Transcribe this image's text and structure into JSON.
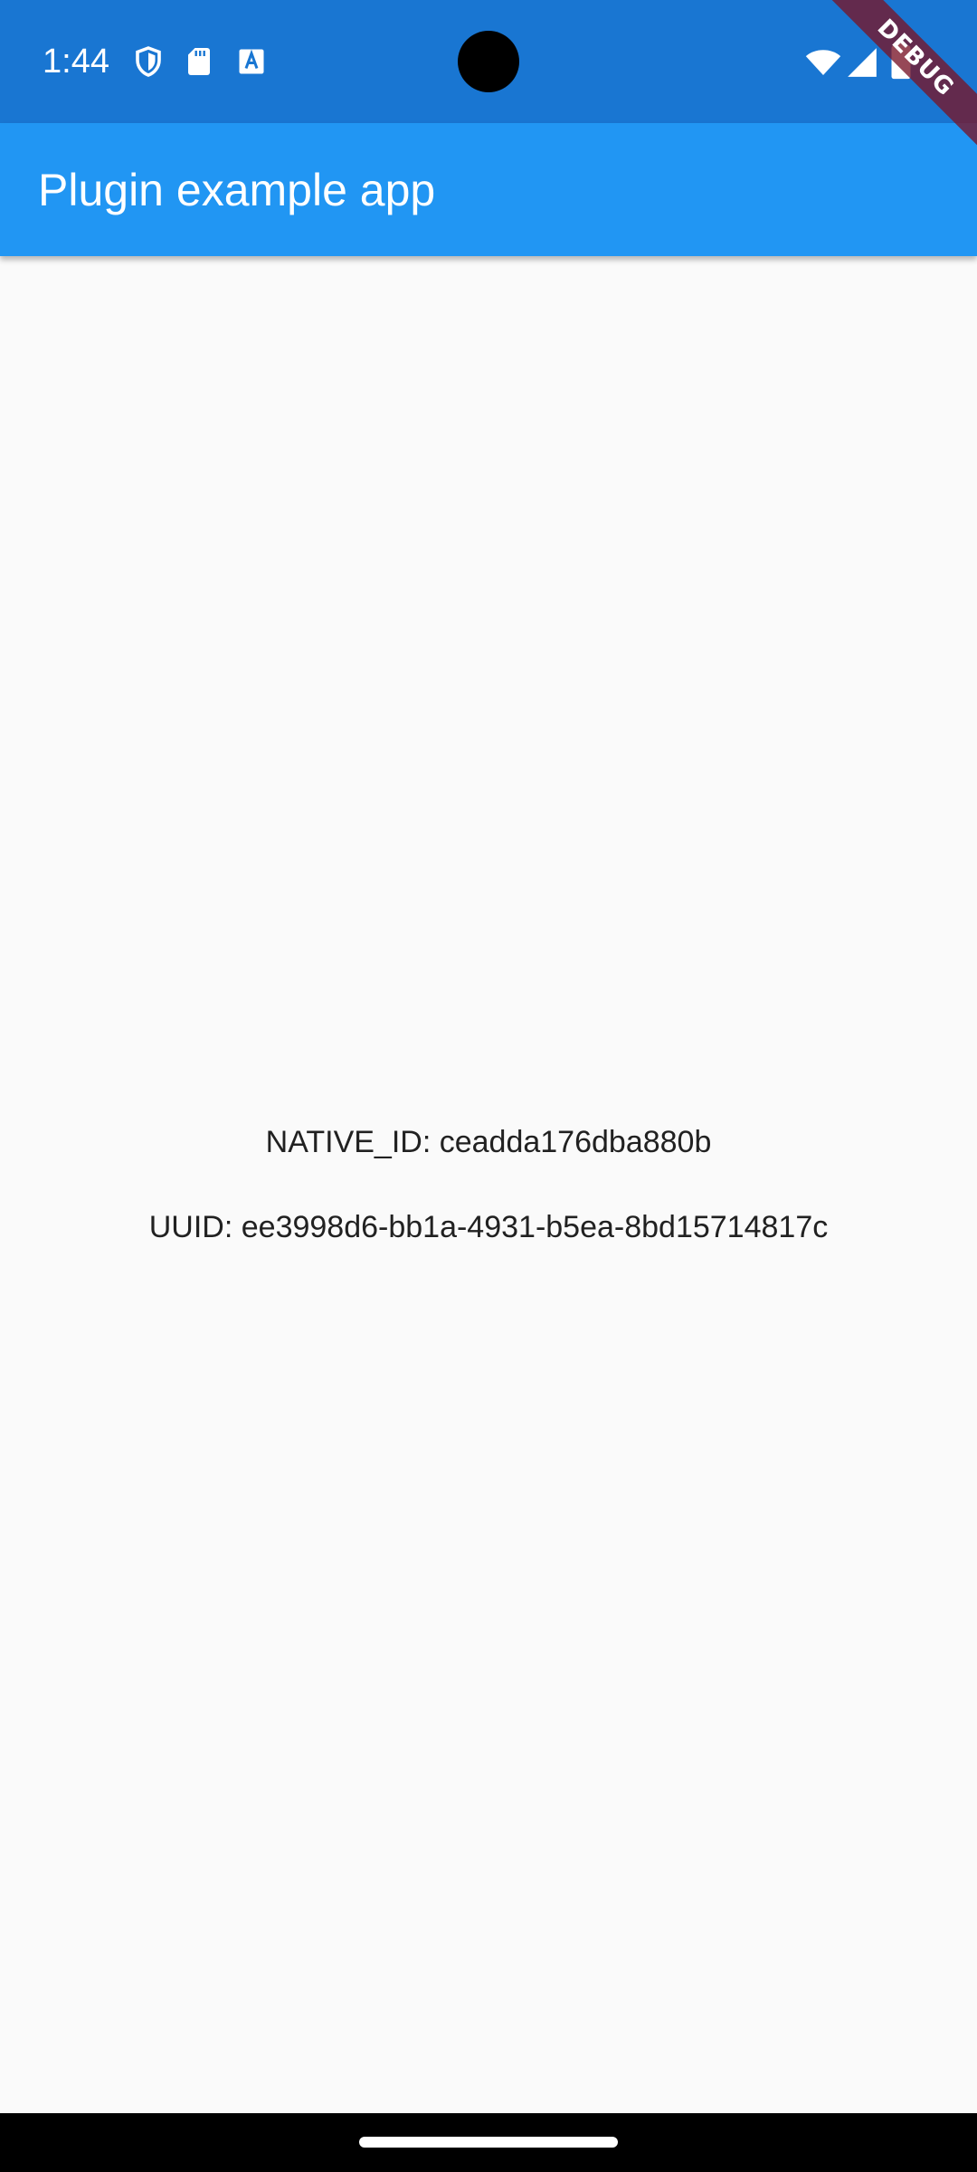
{
  "status_bar": {
    "time": "1:44",
    "background": "#1976d2",
    "left_icons": [
      "shield-icon",
      "sd-card-icon",
      "text-a-icon"
    ],
    "right_icons": [
      "wifi-icon",
      "cellular-signal-icon",
      "battery-icon"
    ]
  },
  "debug_banner": {
    "label": "DEBUG"
  },
  "app_bar": {
    "title": "Plugin example app",
    "background": "#2196f3"
  },
  "content": {
    "native_id": "NATIVE_ID: ceadda176dba880b",
    "uuid": "UUID: ee3998d6-bb1a-4931-b5ea-8bd15714817c"
  },
  "colors": {
    "page_background": "#fafafa",
    "text": "#212121"
  }
}
